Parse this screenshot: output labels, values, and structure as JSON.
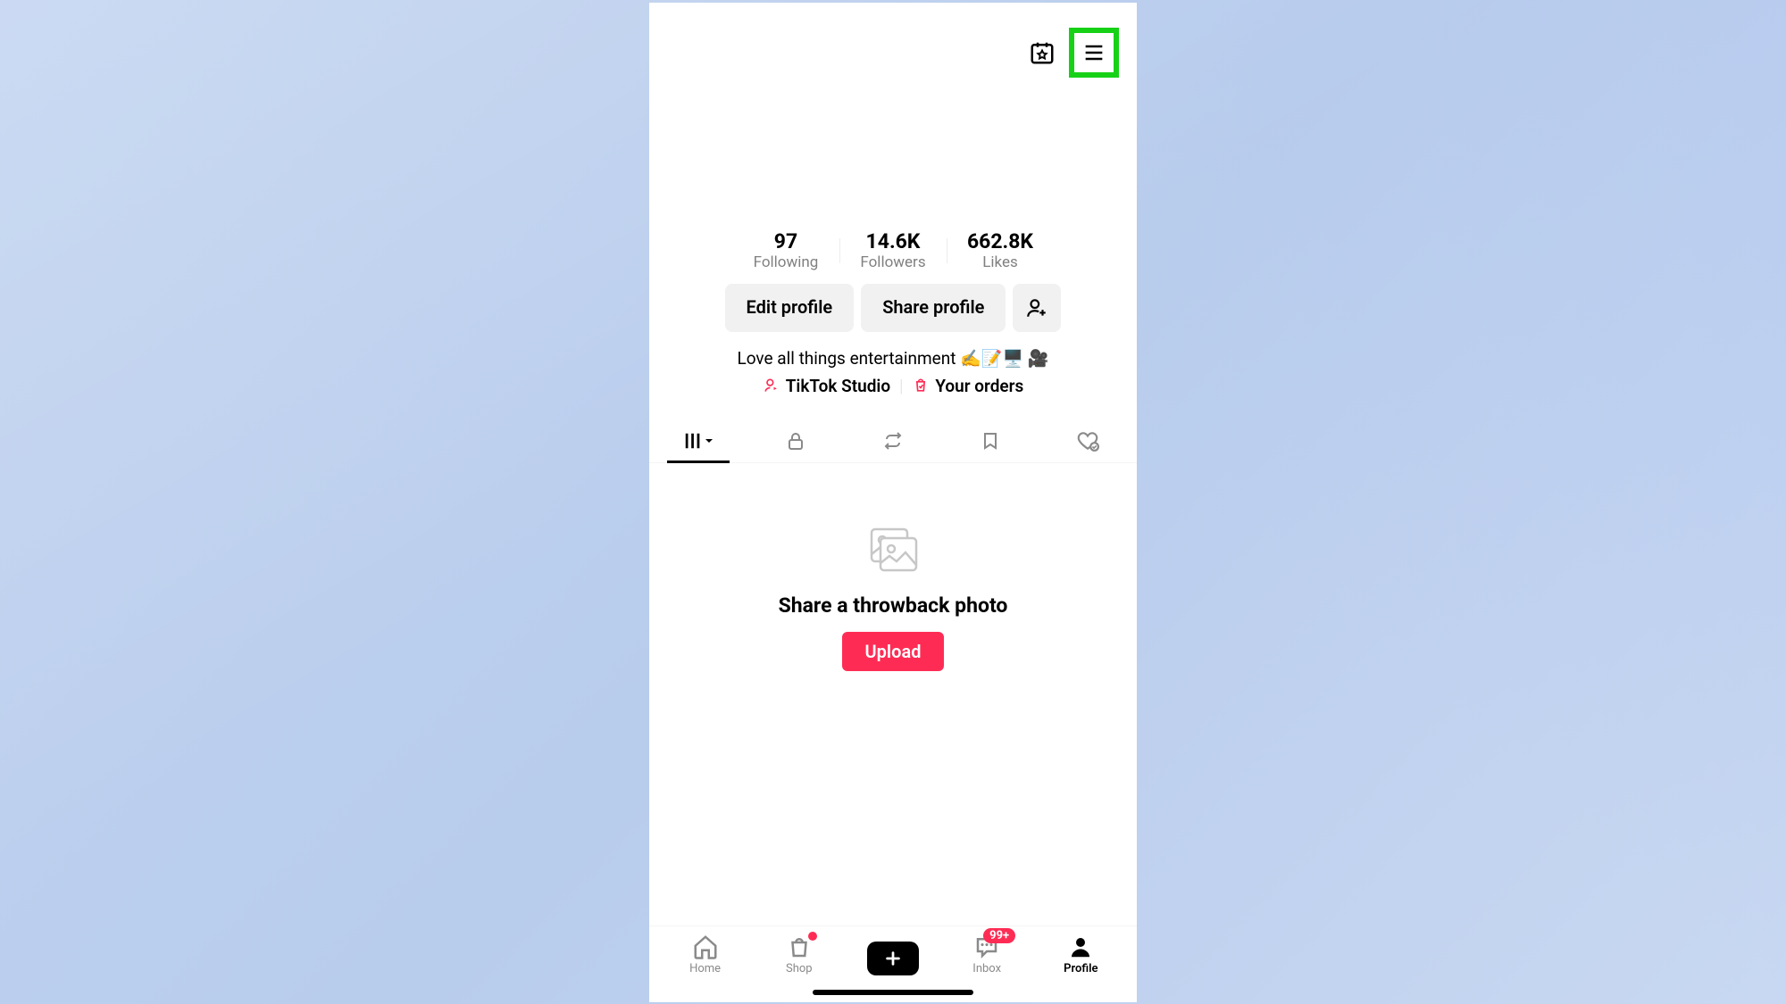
{
  "stats": {
    "following": {
      "count": "97",
      "label": "Following"
    },
    "followers": {
      "count": "14.6K",
      "label": "Followers"
    },
    "likes": {
      "count": "662.8K",
      "label": "Likes"
    }
  },
  "actions": {
    "edit_label": "Edit profile",
    "share_label": "Share profile"
  },
  "bio": {
    "text": "Love all things entertainment ✍️📝🖥️ 🎥"
  },
  "links": {
    "studio": "TikTok Studio",
    "orders": "Your orders"
  },
  "empty_state": {
    "title": "Share a throwback photo",
    "upload_label": "Upload"
  },
  "bottom_nav": {
    "home": "Home",
    "shop": "Shop",
    "inbox": "Inbox",
    "profile": "Profile",
    "inbox_badge": "99+"
  }
}
